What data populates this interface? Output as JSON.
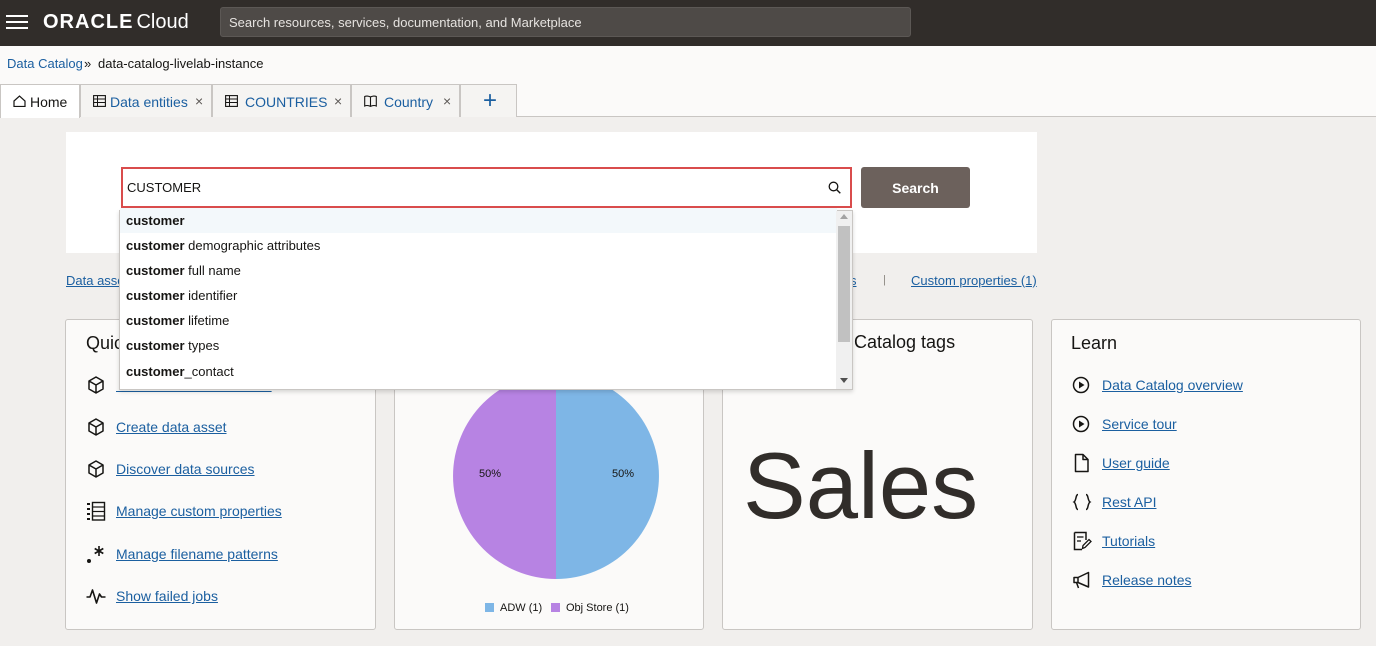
{
  "header": {
    "brand": "ORACLE",
    "product": "Cloud",
    "search_placeholder": "Search resources, services, documentation, and Marketplace"
  },
  "breadcrumb": {
    "root": "Data Catalog",
    "separator": "»",
    "current": "data-catalog-livelab-instance"
  },
  "tabs": [
    {
      "label": "Home",
      "icon": "home-icon",
      "active": true
    },
    {
      "label": "Data entities",
      "icon": "table-icon",
      "closable": true
    },
    {
      "label": "COUNTRIES",
      "icon": "table-icon",
      "closable": true
    },
    {
      "label": "Country",
      "icon": "book-icon",
      "closable": true
    }
  ],
  "tab_add_label": "+",
  "tab_close_label": "×",
  "search": {
    "value": "CUSTOMER",
    "button_label": "Search",
    "suggestions": [
      {
        "bold": "customer",
        "rest": ""
      },
      {
        "bold": "customer",
        "rest": " demographic attributes"
      },
      {
        "bold": "customer",
        "rest": " full name"
      },
      {
        "bold": "customer",
        "rest": " identifier"
      },
      {
        "bold": "customer",
        "rest": " lifetime"
      },
      {
        "bold": "customer",
        "rest": " types"
      },
      {
        "bold": "customer",
        "rest": "_contact"
      }
    ]
  },
  "summary_links": {
    "left_partial": "Data asse",
    "mid_partial": "s",
    "separator": "|",
    "custom_properties": "Custom properties (1)"
  },
  "quick_actions": {
    "title_partial": "Quic",
    "items": [
      {
        "label": "",
        "icon": "cube-icon"
      },
      {
        "label": "Create data asset",
        "icon": "cube-icon"
      },
      {
        "label": "Discover data sources",
        "icon": "cube-icon"
      },
      {
        "label": "Manage custom properties",
        "icon": "list-icon"
      },
      {
        "label": "Manage filename patterns",
        "icon": "pattern-icon"
      },
      {
        "label": "Show failed jobs",
        "icon": "pulse-icon"
      }
    ]
  },
  "chart_data": {
    "type": "pie",
    "categories": [
      "ADW",
      "Obj Store"
    ],
    "values": [
      1,
      1
    ],
    "percent_labels": [
      "50%",
      "50%"
    ],
    "legend": [
      "ADW (1)",
      "Obj Store (1)"
    ],
    "colors": [
      "#7eb6e6",
      "#b783e3"
    ],
    "legend_position": "bottom"
  },
  "catalog_tags": {
    "title_partial": "Catalog tags",
    "tag": "Sales"
  },
  "learn": {
    "title": "Learn",
    "items": [
      {
        "label": "Data Catalog overview",
        "icon": "play-icon"
      },
      {
        "label": "Service tour",
        "icon": "play-icon"
      },
      {
        "label": "User guide",
        "icon": "document-icon"
      },
      {
        "label": "Rest API",
        "icon": "braces-icon"
      },
      {
        "label": "Tutorials",
        "icon": "tutorial-icon"
      },
      {
        "label": "Release notes",
        "icon": "megaphone-icon"
      }
    ]
  },
  "colors": {
    "header_bg": "#312d2a",
    "link": "#1b5fa0",
    "search_button": "#6c615c",
    "highlight_border": "#d94c4c"
  }
}
